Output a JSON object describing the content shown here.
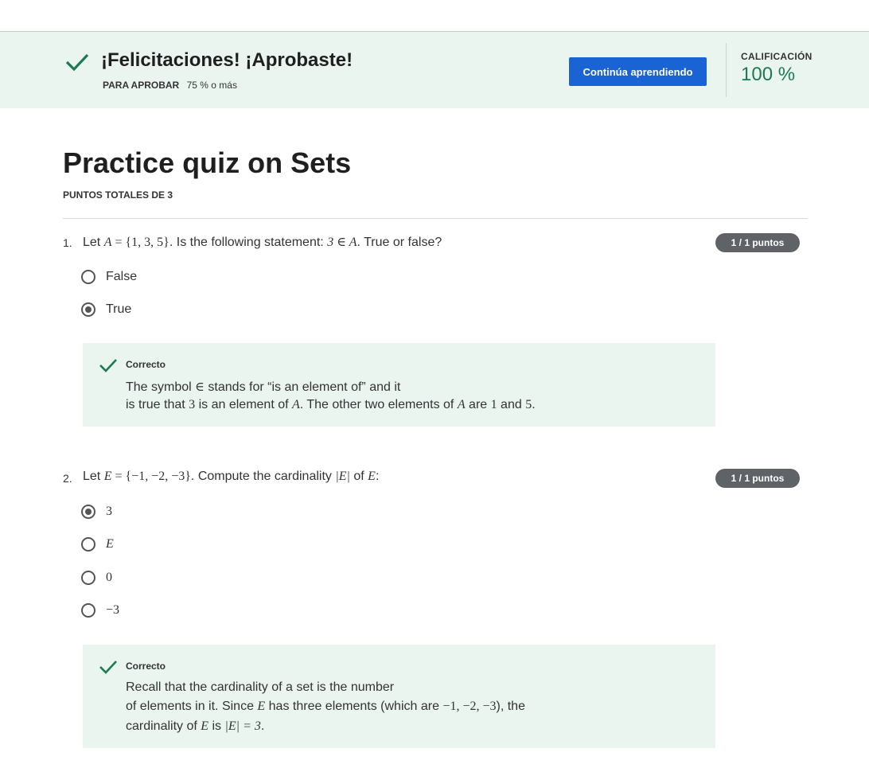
{
  "banner": {
    "title": "¡Felicitaciones! ¡Aprobaste!",
    "pass_label": "PARA APROBAR",
    "pass_value": "75 % o más",
    "continue_label": "Continúa aprendiendo",
    "grade_label": "CALIFICACIÓN",
    "grade_value": "100 %",
    "colors": {
      "accent": "#1a63d4",
      "success": "#1d7a52",
      "banner_bg": "#eaf5f0"
    }
  },
  "quiz": {
    "title": "Practice quiz on Sets",
    "total_points": "PUNTOS TOTALES DE 3"
  },
  "questions": [
    {
      "number": "1.",
      "text": {
        "t1": "Let ",
        "m1": "A",
        "t2": " = {1, 3, 5}",
        "t3": ". Is the following statement:  ",
        "m2": "3 ∈ A",
        "t4": ".  True or false?"
      },
      "points": "1 / 1 puntos",
      "options": [
        {
          "label": "False",
          "selected": false
        },
        {
          "label": "True",
          "selected": true
        }
      ],
      "feedback": {
        "title": "Correcto",
        "line1": {
          "a": "The symbol ",
          "b": "∈",
          "c": " stands for “is an element of” and it"
        },
        "line2": {
          "a": "is true that ",
          "b": "3",
          "c": " is an element of ",
          "d": "A",
          "e": ". The other two elements of ",
          "f": "A",
          "g": " are ",
          "h": "1",
          "i": " and ",
          "j": "5",
          "k": "."
        }
      }
    },
    {
      "number": "2.",
      "text": {
        "t1": "Let ",
        "m1": "E",
        "t2": " = {−1, −2, −3}",
        "t3": ". Compute the cardinality ",
        "m2": "|E|",
        "t4": " of ",
        "m3": "E",
        "t5": ":"
      },
      "points": "1 / 1 puntos",
      "options": [
        {
          "label": "3",
          "selected": true
        },
        {
          "label": "E",
          "selected": false
        },
        {
          "label": "0",
          "selected": false
        },
        {
          "label": "−3",
          "selected": false
        }
      ],
      "feedback": {
        "title": "Correcto",
        "line1": {
          "a": "Recall that the cardinality of a set is the number"
        },
        "line2": {
          "a": "of elements in it. Since ",
          "b": "E",
          "c": " has three elements (which are ",
          "d": "−1, −2, −3",
          "e": "), the"
        },
        "line3": {
          "a": "cardinality of ",
          "b": "E",
          "c": " is ",
          "d": "|E| = 3",
          "e": "."
        }
      }
    }
  ]
}
